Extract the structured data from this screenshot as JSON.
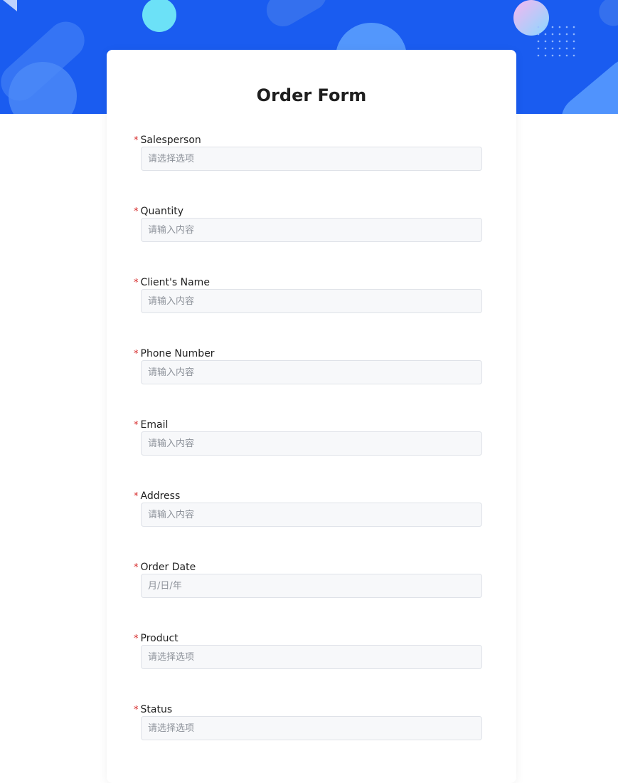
{
  "page": {
    "title": "Order Form"
  },
  "colors": {
    "banner": "#1a5cf0",
    "required_marker": "#d62b2b",
    "input_bg": "#f7f8fa"
  },
  "fields": [
    {
      "label": "Salesperson",
      "required_marker": "*",
      "placeholder": "请选择选项"
    },
    {
      "label": "Quantity",
      "required_marker": "*",
      "placeholder": "请输入内容"
    },
    {
      "label": "Client's Name",
      "required_marker": "*",
      "placeholder": "请输入内容"
    },
    {
      "label": "Phone Number",
      "required_marker": "*",
      "placeholder": "请输入内容"
    },
    {
      "label": "Email",
      "required_marker": "*",
      "placeholder": "请输入内容"
    },
    {
      "label": "Address",
      "required_marker": "*",
      "placeholder": "请输入内容"
    },
    {
      "label": "Order Date",
      "required_marker": "*",
      "placeholder": "月/日/年"
    },
    {
      "label": "Product",
      "required_marker": "*",
      "placeholder": "请选择选项"
    },
    {
      "label": "Status",
      "required_marker": "*",
      "placeholder": "请选择选项"
    }
  ]
}
